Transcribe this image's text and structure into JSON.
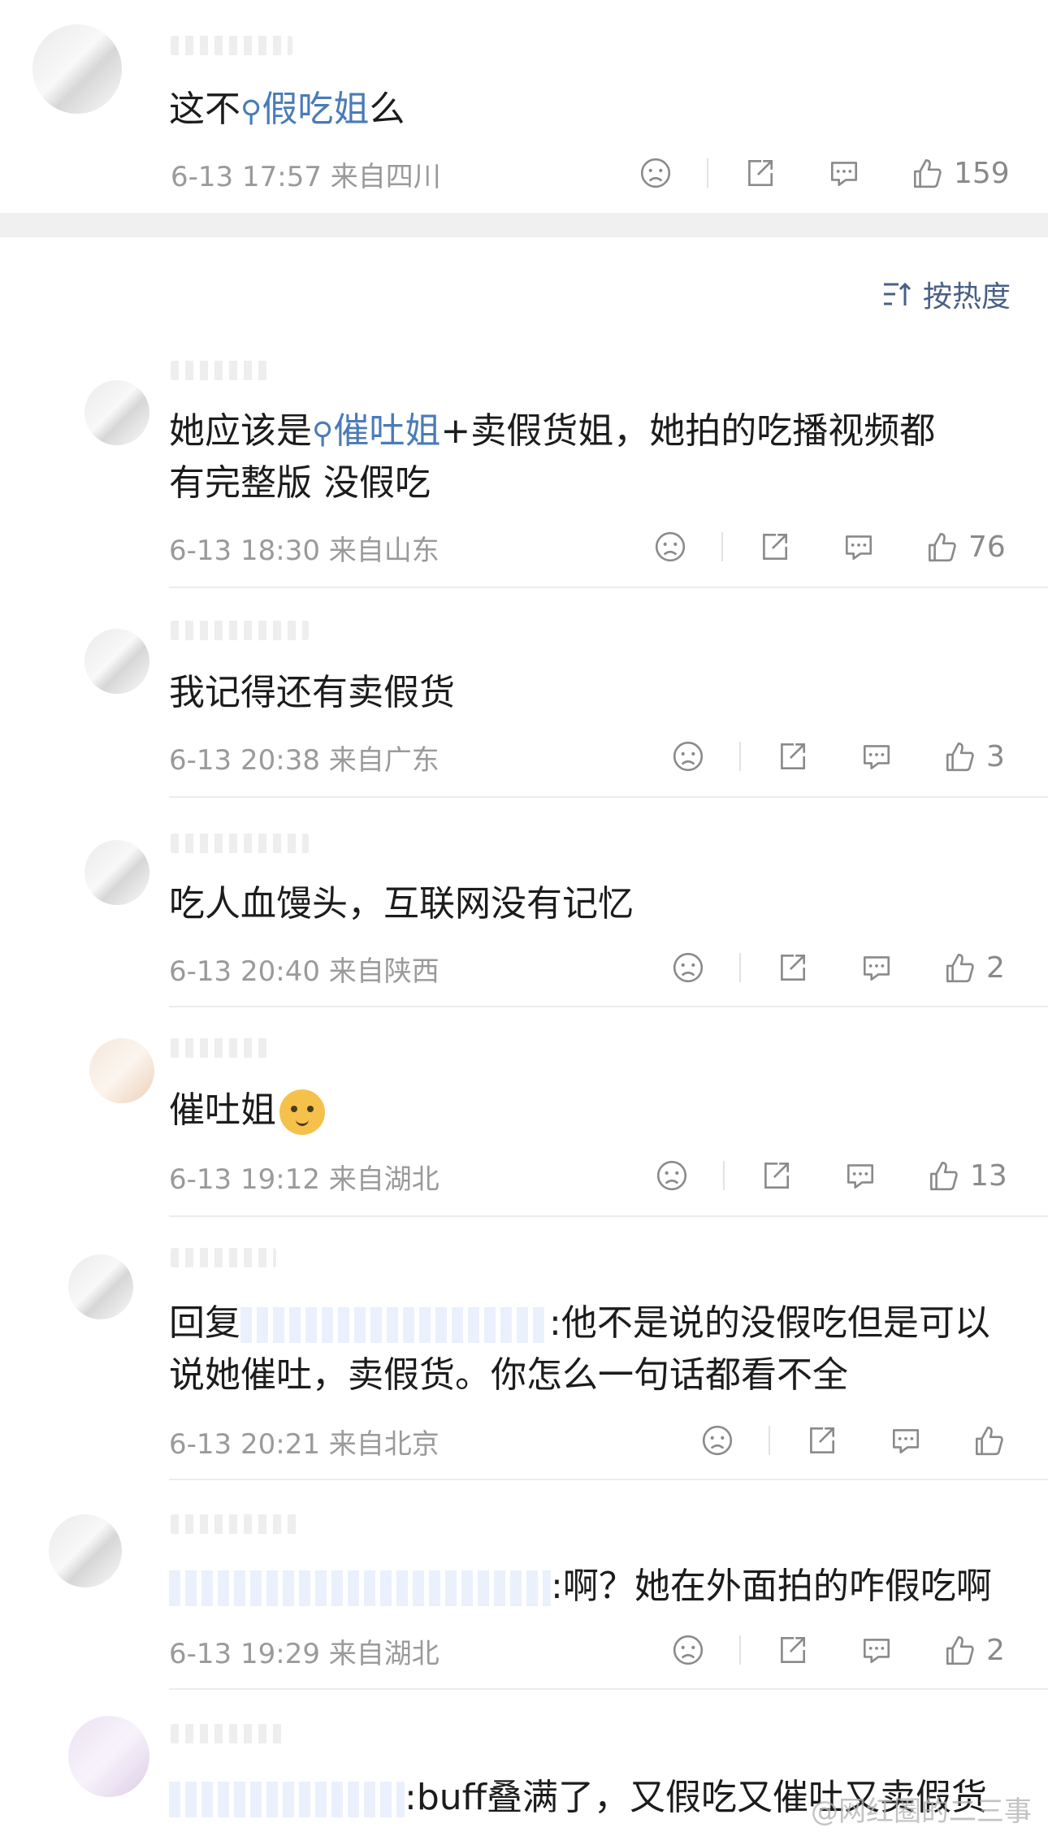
{
  "top_comment": {
    "text_prefix": "这不",
    "topic": "假吃姐",
    "text_suffix": "么",
    "meta": "6-13 17:57  来自四川",
    "like_count": "159"
  },
  "sort_label": "按热度",
  "replies": [
    {
      "text_prefix": "她应该是",
      "topic": "催吐姐",
      "text_suffix": "+卖假货姐，她拍的吃播视频都",
      "text_line2": "有完整版 没假吃",
      "meta": "6-13 18:30  来自山东",
      "like_count": "76"
    },
    {
      "text": "我记得还有卖假货",
      "meta": "6-13 20:38  来自广东",
      "like_count": "3"
    },
    {
      "text": "吃人血馒头，互联网没有记忆",
      "meta": "6-13 20:40  来自陕西",
      "like_count": "2"
    },
    {
      "text": "催吐姐",
      "meta": "6-13 19:12  来自湖北",
      "like_count": "13"
    },
    {
      "text_prefix": "回复",
      "text_suffix": ":他不是说的没假吃但是可以",
      "text_line2": "说她催吐，卖假货。你怎么一句话都看不全",
      "meta": "6-13 20:21  来自北京",
      "like_count": ""
    },
    {
      "text_suffix": ":啊？她在外面拍的咋假吃啊",
      "meta": "6-13 19:29  来自湖北",
      "like_count": "2"
    },
    {
      "text_suffix": ":buff叠满了，又假吃又催吐又卖假货"
    }
  ],
  "watermark": "@网红圈的二三事",
  "icons": {
    "dislike": "sad-face-icon",
    "share": "share-icon",
    "comment": "comment-icon",
    "like": "thumbs-up-icon",
    "sort": "sort-icon",
    "search": "search-icon"
  }
}
